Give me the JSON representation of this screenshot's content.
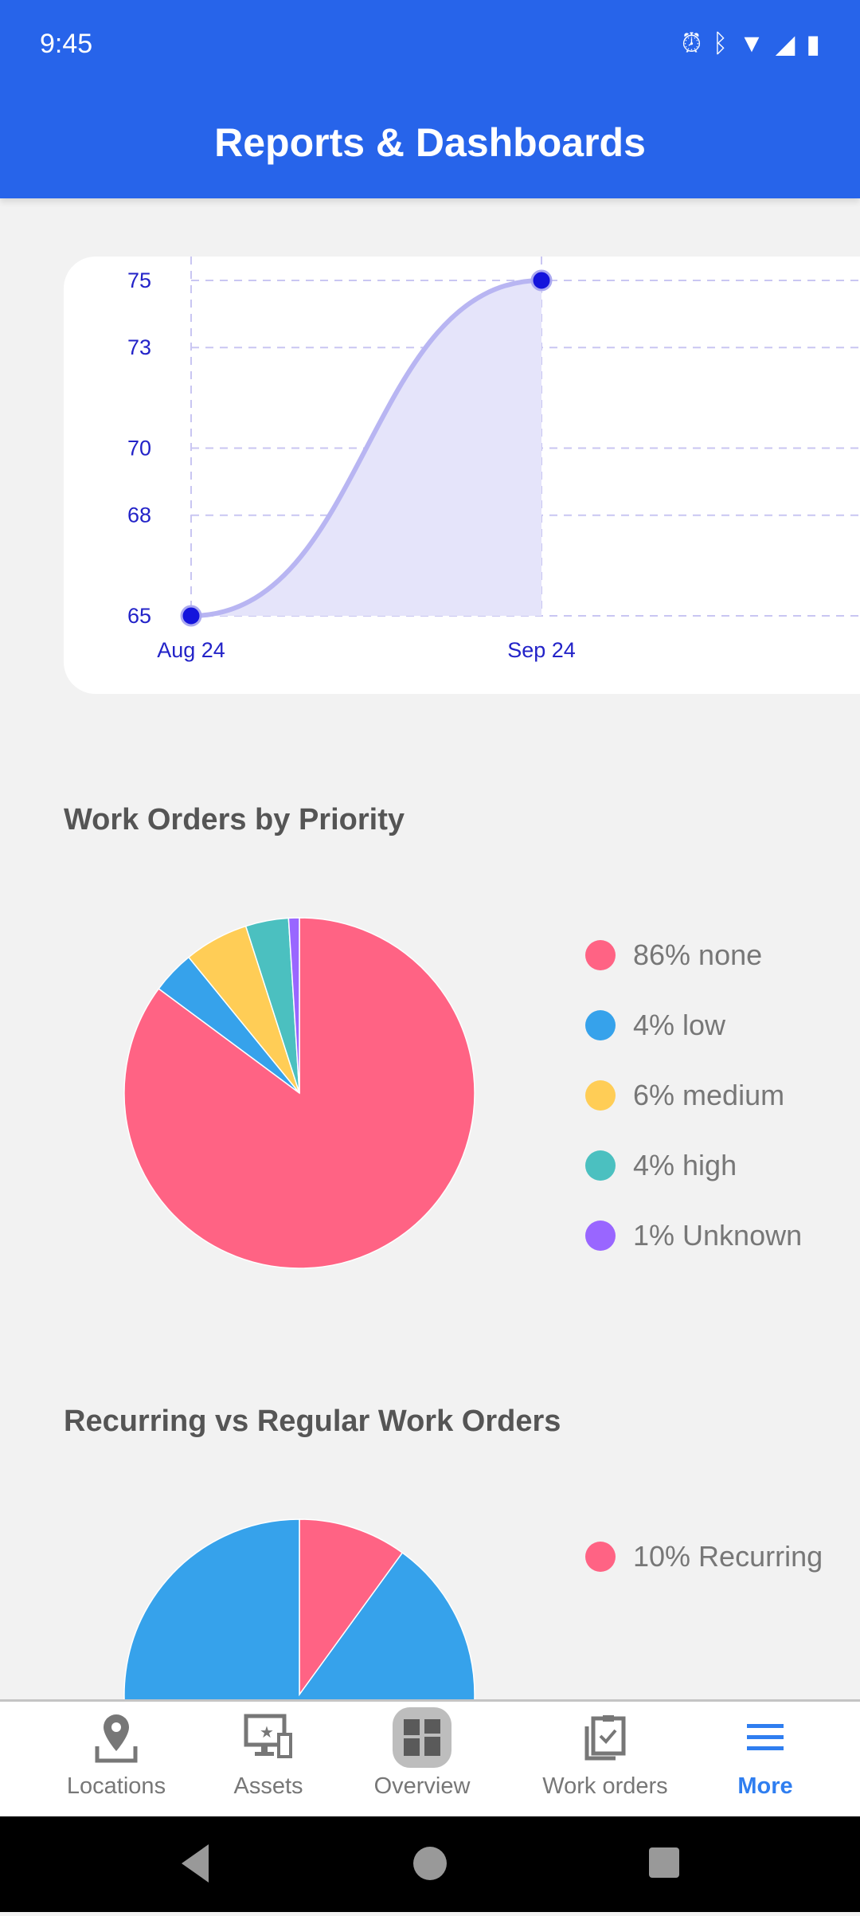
{
  "status_bar": {
    "time": "9:45",
    "icons": [
      "alarm-icon",
      "bluetooth-icon",
      "wifi-icon",
      "signal-icon",
      "battery-icon"
    ]
  },
  "header": {
    "title": "Reports & Dashboards"
  },
  "chart_data": [
    {
      "type": "area",
      "x": [
        "Aug 24",
        "Sep 24"
      ],
      "values": [
        65,
        75
      ],
      "yticks": [
        "75",
        "73",
        "70",
        "68",
        "65"
      ],
      "ylim": [
        65,
        75
      ],
      "grid": true,
      "colors": {
        "line": "#b8b5f2",
        "fill": "#e5e4fa",
        "point": "#1414dc",
        "text": "#2323c8"
      }
    },
    {
      "type": "pie",
      "title": "Work Orders by Priority",
      "categories": [
        "none",
        "low",
        "medium",
        "high",
        "Unknown"
      ],
      "values": [
        86,
        4,
        6,
        4,
        1
      ],
      "legend": [
        "86% none",
        "4% low",
        "6% medium",
        "4% high",
        "1% Unknown"
      ],
      "legend_placement": "right",
      "colors": [
        "#ff6384",
        "#36a2eb",
        "#ffcd56",
        "#4bc0c0",
        "#9966ff"
      ]
    },
    {
      "type": "pie",
      "title": "Recurring vs Regular Work Orders",
      "categories": [
        "Recurring",
        "Regular"
      ],
      "values": [
        10,
        90
      ],
      "legend": [
        "10% Recurring"
      ],
      "legend_placement": "right",
      "colors": [
        "#ff6384",
        "#36a2eb"
      ]
    }
  ],
  "bottom_nav": {
    "items": [
      {
        "label": "Locations",
        "icon": "location-pin-icon"
      },
      {
        "label": "Assets",
        "icon": "assets-icon"
      },
      {
        "label": "Overview",
        "icon": "dashboard-icon"
      },
      {
        "label": "Work orders",
        "icon": "clipboard-check-icon"
      },
      {
        "label": "More",
        "icon": "menu-icon"
      }
    ],
    "active": "More",
    "accent": "#2f7ef0"
  }
}
